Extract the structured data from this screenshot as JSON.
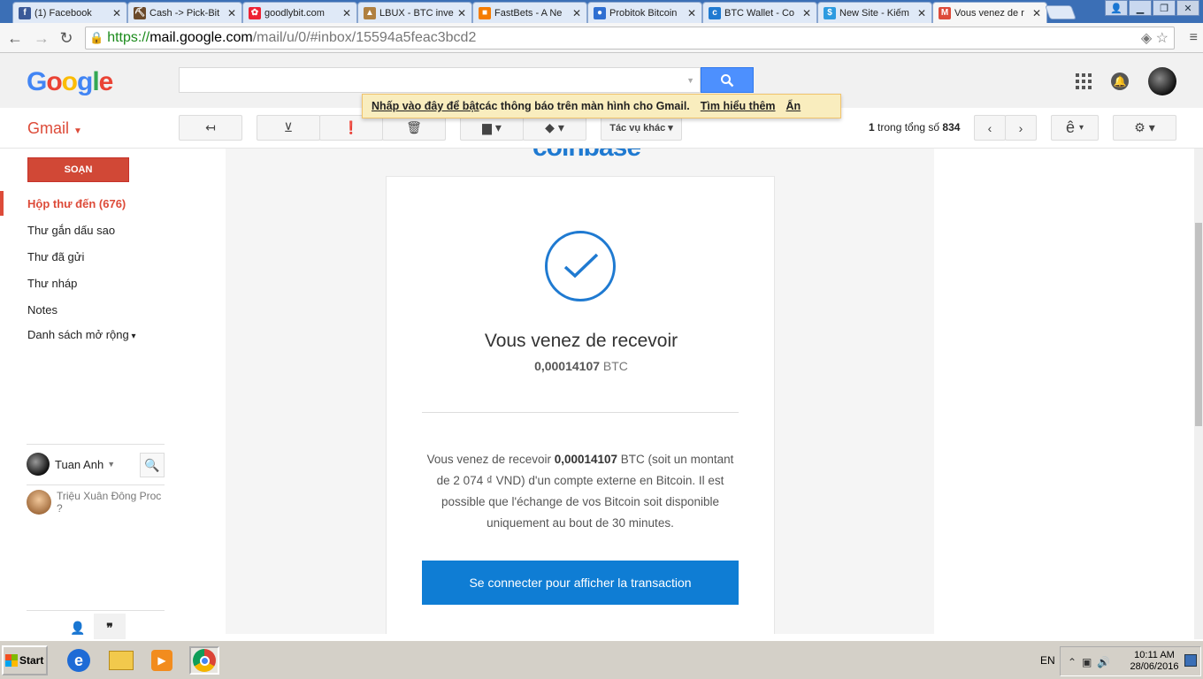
{
  "browser": {
    "tabs": [
      {
        "label": "(1) Facebook",
        "icon": "facebook-icon",
        "color": "#3b5998",
        "glyph": "f",
        "left": 0
      },
      {
        "label": "Cash -> Pick-Bit",
        "icon": "pickaxe-icon",
        "color": "#6b4a2b",
        "glyph": "⛏",
        "left": 0
      },
      {
        "label": "goodlybit.com",
        "icon": "goodlybit-icon",
        "color": "#e23",
        "glyph": "✿",
        "left": 0
      },
      {
        "label": "LBUX - BTC inve",
        "icon": "lbux-icon",
        "color": "#b08040",
        "glyph": "▲",
        "left": 0
      },
      {
        "label": "FastBets - A Ne",
        "icon": "fastbets-icon",
        "color": "#f57c00",
        "glyph": "■",
        "left": 0
      },
      {
        "label": "Probitok Bitcoin",
        "icon": "probitok-icon",
        "color": "#2f6fd1",
        "glyph": "●",
        "left": 0
      },
      {
        "label": "BTC Wallet - Co",
        "icon": "coinbase-icon",
        "color": "#1f7ad1",
        "glyph": "c",
        "left": 0
      },
      {
        "label": "New Site - Kiếm",
        "icon": "dollar-icon",
        "color": "#2d9be0",
        "glyph": "$",
        "left": 0
      },
      {
        "label": "Vous venez de r",
        "icon": "gmail-icon",
        "color": "#dd4b39",
        "glyph": "M",
        "left": 0
      }
    ],
    "tab_close_glyph": "✕",
    "address": {
      "scheme": "https://",
      "host": "mail.google.com",
      "path": "/mail/u/0/#inbox/15594a5feac3bcd2"
    }
  },
  "gmail": {
    "logo_letters": [
      {
        "ch": "G",
        "color": "#4285f4"
      },
      {
        "ch": "o",
        "color": "#ea4335"
      },
      {
        "ch": "o",
        "color": "#fbbc05"
      },
      {
        "ch": "g",
        "color": "#4285f4"
      },
      {
        "ch": "l",
        "color": "#34a853"
      },
      {
        "ch": "e",
        "color": "#ea4335"
      }
    ],
    "app_label": "Gmail",
    "notification": {
      "link_text": "Nhấp vào đây để bật",
      "text": " các thông báo trên màn hình cho Gmail.",
      "learn_more": "Tìm hiểu thêm",
      "hide": "Ẩn"
    },
    "toolbar": {
      "more_actions": "Tác vụ khác",
      "pager_current": "1",
      "pager_text": " trong tổng số ",
      "pager_total": "834",
      "input_tool": "ê"
    },
    "sidebar": {
      "compose": "SOẠN",
      "items": [
        {
          "label": "Hộp thư đến (676)",
          "name": "sidebar-item-inbox"
        },
        {
          "label": "Thư gắn dấu sao",
          "name": "sidebar-item-starred"
        },
        {
          "label": "Thư đã gửi",
          "name": "sidebar-item-sent"
        },
        {
          "label": "Thư nháp",
          "name": "sidebar-item-drafts"
        },
        {
          "label": "Notes",
          "name": "sidebar-item-notes"
        },
        {
          "label": "Danh sách mở rộng",
          "name": "sidebar-item-more"
        }
      ],
      "chat_user": "Tuan Anh",
      "contact_name": "Triệu Xuân Đông Proc",
      "contact_status": "?"
    }
  },
  "email": {
    "brand_peek": "coinbase",
    "headline": "Vous venez de recevoir",
    "amount_value": "0,00014107",
    "amount_unit": " BTC",
    "body_prefix": "Vous venez de recevoir ",
    "body_amount": "0,00014107",
    "body_rest": " BTC (soit un montant de 2 074 ₫ VND) d'un compte externe en Bitcoin. Il est possible que l'échange de vos Bitcoin soit disponible uniquement au bout de 30 minutes.",
    "cta": "Se connecter pour afficher la transaction"
  },
  "taskbar": {
    "start": "Start",
    "language": "EN",
    "time": "10:11 AM",
    "date": "28/06/2016"
  }
}
